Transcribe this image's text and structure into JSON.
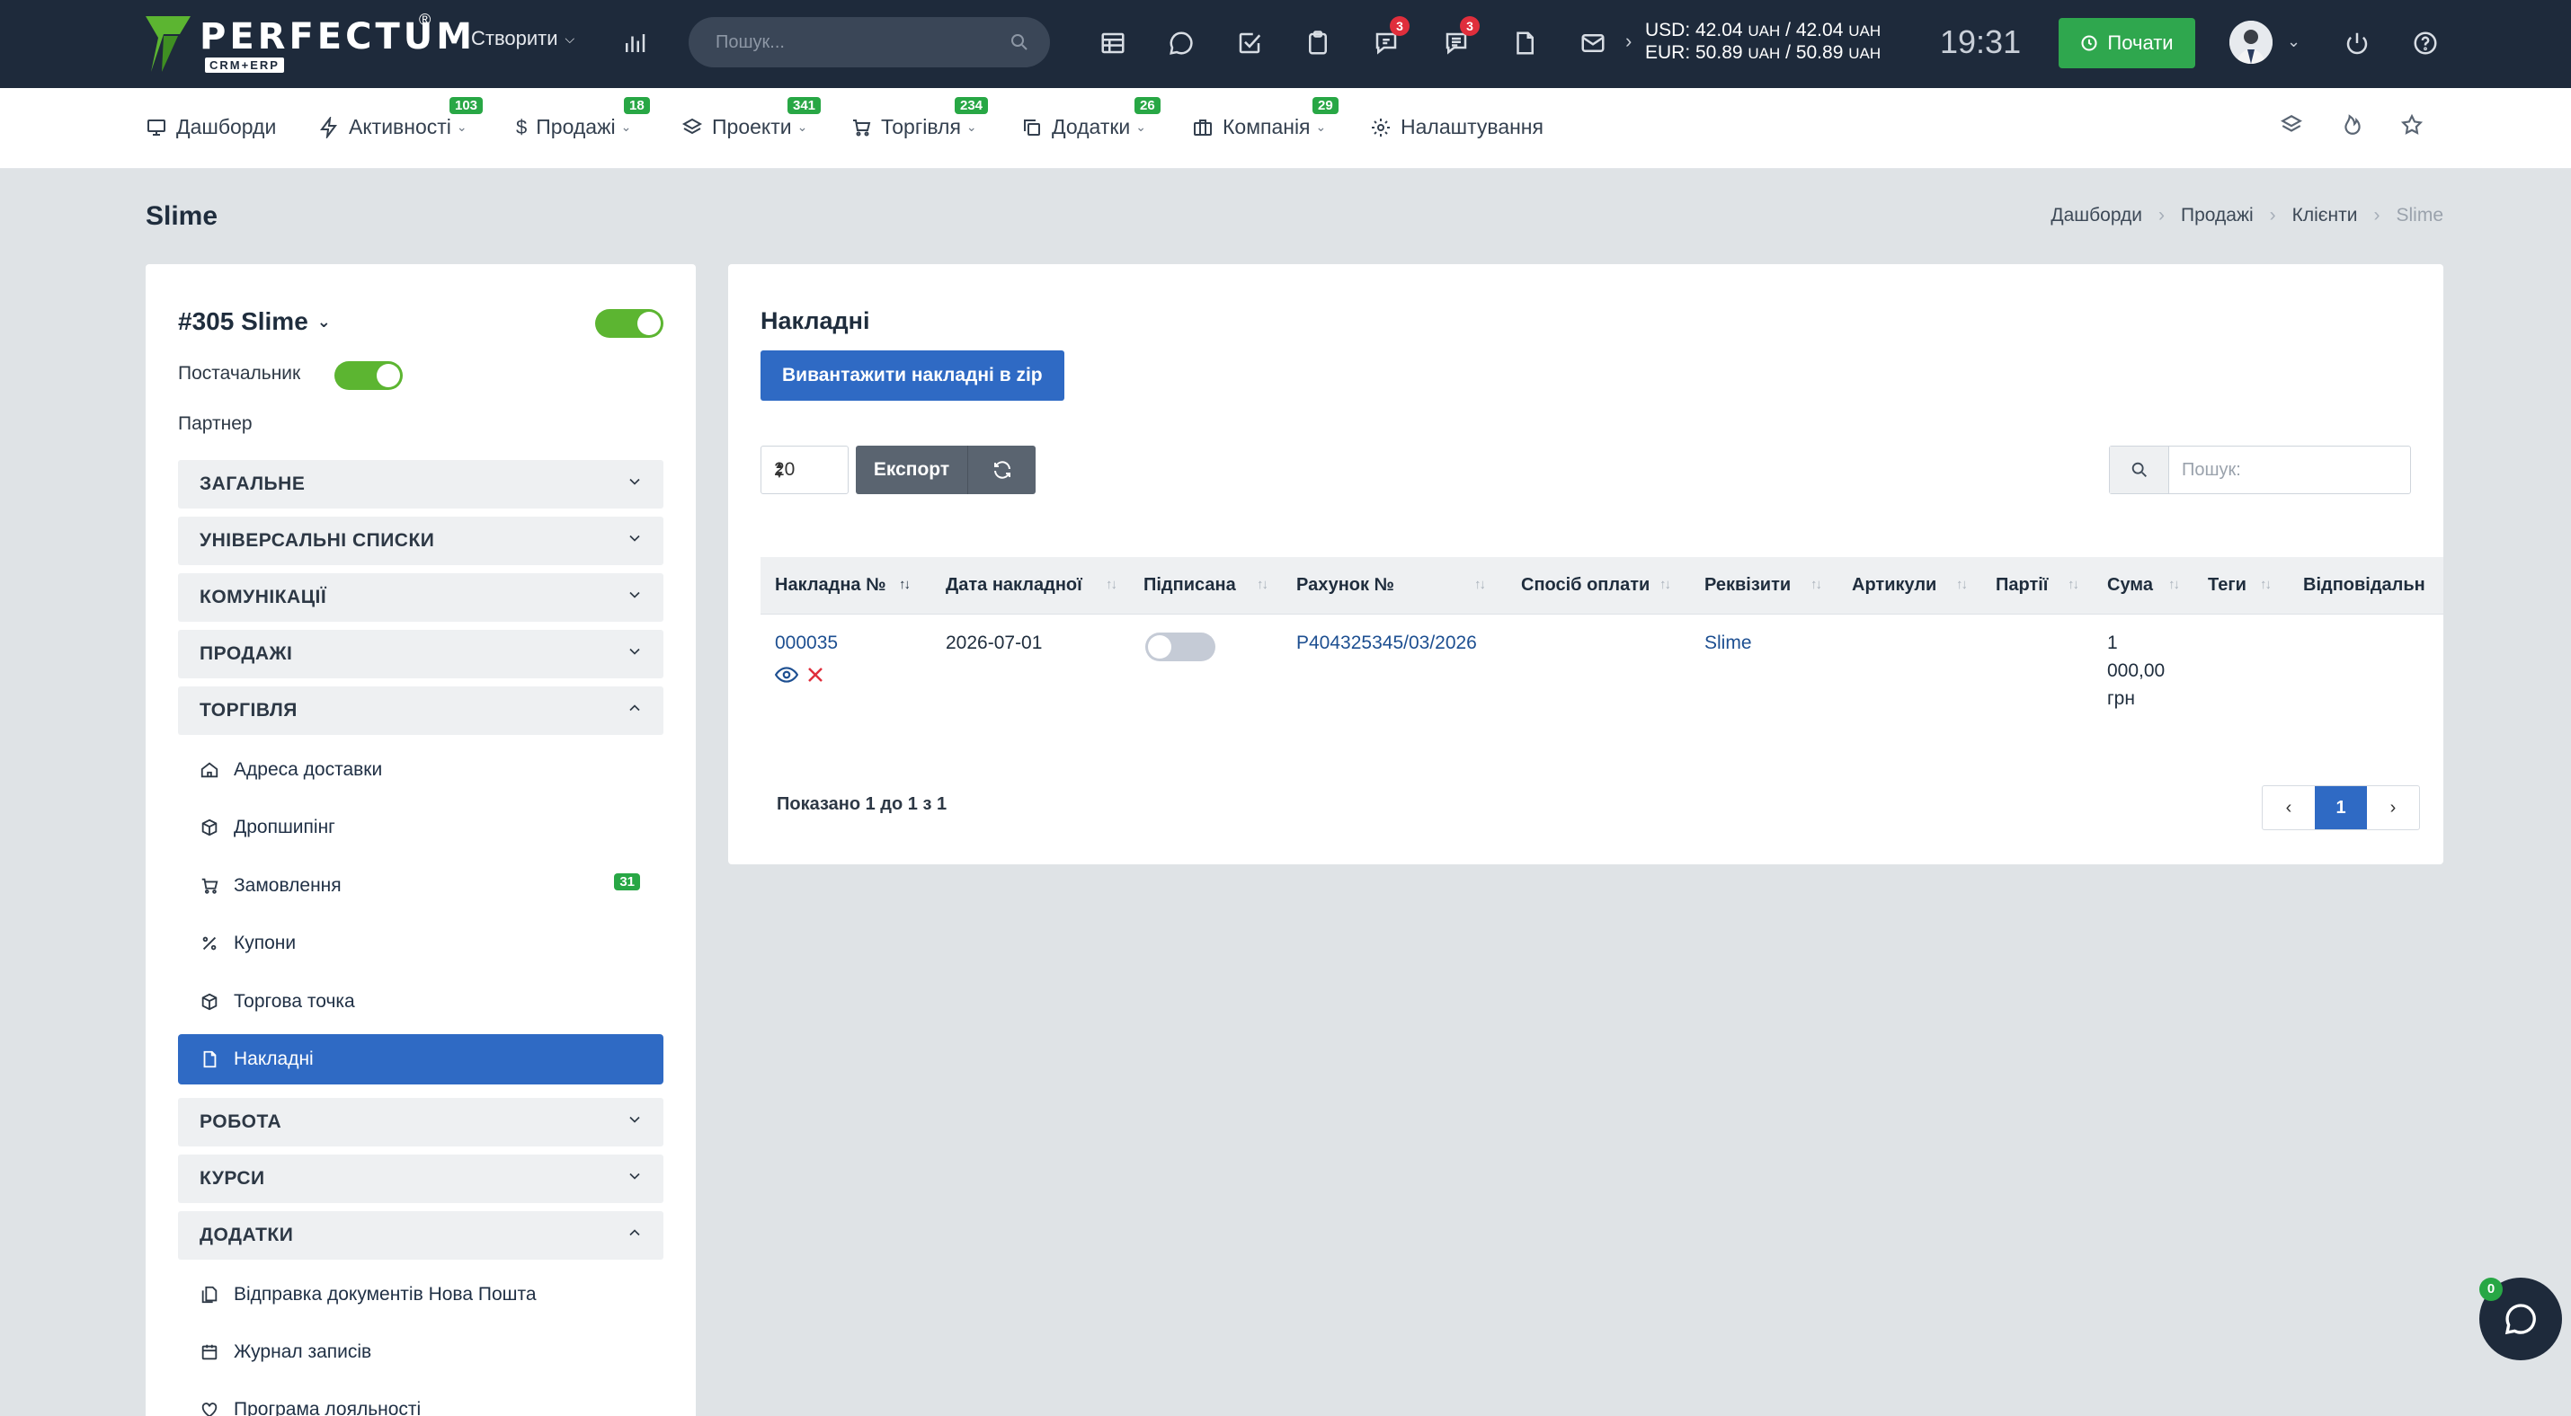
{
  "brand": {
    "name": "PERFECTUM",
    "sub": "CRM+ERP",
    "reg": "®"
  },
  "topbar": {
    "create_label": "Створити",
    "search_placeholder": "Пошук...",
    "icons": [
      {
        "name": "stats-icon"
      },
      {
        "name": "table-icon"
      },
      {
        "name": "chat-icon"
      },
      {
        "name": "tasks-icon"
      },
      {
        "name": "clipboard-icon"
      },
      {
        "name": "support-icon",
        "badge": "3"
      },
      {
        "name": "messages-icon",
        "badge": "3"
      },
      {
        "name": "document-icon"
      },
      {
        "name": "mail-icon"
      }
    ],
    "rates": {
      "usd": "USD: 42.04",
      "usd_unit": "UAH",
      "usd_sep": " / 42.04",
      "usd_unit2": "UAH",
      "eur": "EUR: 50.89",
      "eur_unit": "UAH",
      "eur_sep": " / 50.89",
      "eur_unit2": "UAH"
    },
    "clock": "19:31",
    "start_label": "Почати"
  },
  "menu": {
    "items": [
      {
        "label": "Дашборди",
        "badge": ""
      },
      {
        "label": "Активності",
        "badge": "103"
      },
      {
        "label": "Продажі",
        "badge": "18"
      },
      {
        "label": "Проекти",
        "badge": "341"
      },
      {
        "label": "Торгівля",
        "badge": "234"
      },
      {
        "label": "Додатки",
        "badge": "26"
      },
      {
        "label": "Компанія",
        "badge": "29"
      },
      {
        "label": "Налаштування",
        "badge": ""
      }
    ]
  },
  "page": {
    "title": "Slime",
    "breadcrumb": [
      "Дашборди",
      "Продажі",
      "Клієнти",
      "Slime"
    ]
  },
  "client": {
    "title": "#305 Slime",
    "active": true,
    "supplier_label": "Постачальник",
    "supplier": true,
    "partner_label": "Партнер",
    "sections": {
      "general": "ЗАГАЛЬНЕ",
      "lists": "УНІВЕРСАЛЬНІ СПИСКИ",
      "comms": "КОМУНІКАЦІЇ",
      "sales": "ПРОДАЖІ",
      "trade": "ТОРГІВЛЯ",
      "work": "РОБОТА",
      "courses": "КУРСИ",
      "addons": "ДОДАТКИ"
    },
    "trade_items": [
      {
        "label": "Адреса доставки"
      },
      {
        "label": "Дропшипінг"
      },
      {
        "label": "Замовлення",
        "badge": "31"
      },
      {
        "label": "Купони"
      },
      {
        "label": "Торгова точка"
      },
      {
        "label": "Накладні"
      }
    ],
    "addon_items": [
      {
        "label": "Відправка документів Нова Пошта"
      },
      {
        "label": "Журнал записів"
      },
      {
        "label": "Програма лояльності"
      }
    ]
  },
  "invoices": {
    "title": "Накладні",
    "zip_button": "Вивантажити накладні в zip",
    "page_size": "20",
    "export_label": "Експорт",
    "search_placeholder": "Пошук:",
    "columns": [
      "Накладна №",
      "Дата накладної",
      "Підписана",
      "Рахунок №",
      "Спосіб оплати",
      "Реквізити",
      "Артикули",
      "Партії",
      "Сума",
      "Теги",
      "Відповідальн"
    ],
    "rows": [
      {
        "number": "000035",
        "date": "2026-07-01",
        "signed": false,
        "invoice": "P404325345/03/2026",
        "payment": "",
        "requisites": "Slime",
        "articles": "",
        "batches": "",
        "sum_line1": "1",
        "sum_line2": "000,00",
        "sum_line3": "грн",
        "tags": ""
      }
    ],
    "info": "Показано 1 до 1 з 1",
    "current_page": "1",
    "prev": "‹",
    "next": "›"
  },
  "chat": {
    "badge": "0"
  }
}
